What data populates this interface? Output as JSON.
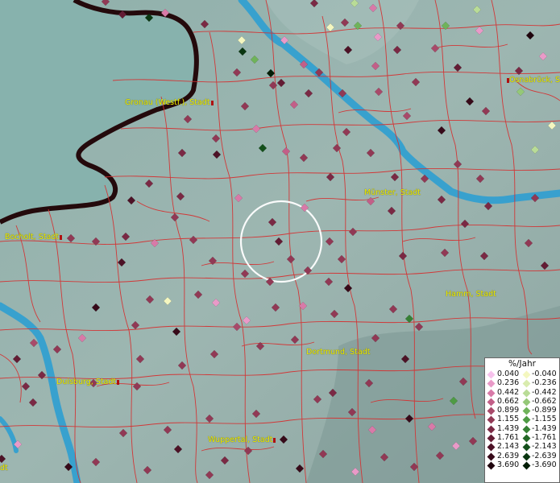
{
  "cities": [
    {
      "id": "gronau",
      "name": "Gronau (Westf.), Stadt"
    },
    {
      "id": "osnabrueck",
      "name": "Osnabrück, S"
    },
    {
      "id": "muenster",
      "name": "Münster, Stadt"
    },
    {
      "id": "bocholt",
      "name": "Bocholt, Stadt"
    },
    {
      "id": "hamm",
      "name": "Hamm, Stadt"
    },
    {
      "id": "dortmund",
      "name": "Dortmund, Stadt"
    },
    {
      "id": "duisburg",
      "name": "Duisburg, Stadt"
    },
    {
      "id": "wuppertal",
      "name": "Wuppertal, Stadt"
    },
    {
      "id": "edge",
      "name": "dt"
    }
  ],
  "legend": {
    "title": "%/Jahr",
    "positive": [
      {
        "value": "0.040",
        "color": "#f6c2ec"
      },
      {
        "value": "0.236",
        "color": "#e99ac8"
      },
      {
        "value": "0.442",
        "color": "#d87aa8"
      },
      {
        "value": "0.662",
        "color": "#c25f88"
      },
      {
        "value": "0.899",
        "color": "#a84a6a"
      },
      {
        "value": "1.155",
        "color": "#913955"
      },
      {
        "value": "1.439",
        "color": "#7a2944"
      },
      {
        "value": "1.761",
        "color": "#631c34"
      },
      {
        "value": "2.143",
        "color": "#4d1226"
      },
      {
        "value": "2.639",
        "color": "#370a19"
      },
      {
        "value": "3.690",
        "color": "#1f040d"
      }
    ],
    "negative": [
      {
        "value": "-0.040",
        "color": "#f4f7c0"
      },
      {
        "value": "-0.236",
        "color": "#d9ecae"
      },
      {
        "value": "-0.442",
        "color": "#b9dc97"
      },
      {
        "value": "-0.662",
        "color": "#95c878"
      },
      {
        "value": "-0.899",
        "color": "#6fb35a"
      },
      {
        "value": "-1.155",
        "color": "#4e9b44"
      },
      {
        "value": "-1.439",
        "color": "#368134"
      },
      {
        "value": "-1.761",
        "color": "#236826"
      },
      {
        "value": "-2.143",
        "color": "#14501b"
      },
      {
        "value": "-2.639",
        "color": "#0a3711"
      },
      {
        "value": "-3.690",
        "color": "#031e07"
      }
    ]
  },
  "layers": {
    "terrain_color": "#8fa9a5",
    "lowland_color": "#9fbcb8",
    "neighbour_country_color": "#89b3ae",
    "river_color": "#2e9fd2",
    "border_color": "#250b0d",
    "boundary_color": "#d43232",
    "highlight_circle_color": "#ffffff"
  }
}
